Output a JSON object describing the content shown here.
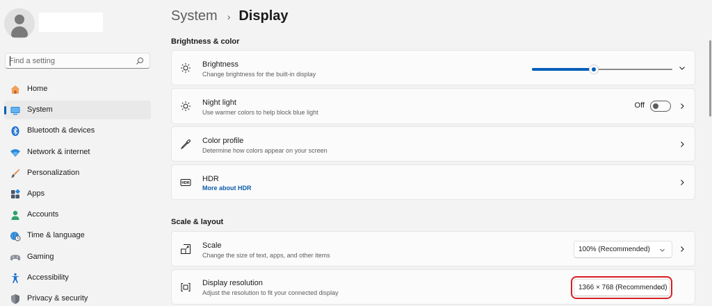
{
  "sidebar": {
    "search": {
      "placeholder": "Find a setting"
    },
    "items": [
      {
        "label": "Home",
        "icon": "home-icon",
        "active": false
      },
      {
        "label": "System",
        "icon": "system-icon",
        "active": true
      },
      {
        "label": "Bluetooth & devices",
        "icon": "bluetooth-icon",
        "active": false
      },
      {
        "label": "Network & internet",
        "icon": "wifi-icon",
        "active": false
      },
      {
        "label": "Personalization",
        "icon": "brush-icon",
        "active": false
      },
      {
        "label": "Apps",
        "icon": "apps-icon",
        "active": false
      },
      {
        "label": "Accounts",
        "icon": "accounts-icon",
        "active": false
      },
      {
        "label": "Time & language",
        "icon": "globe-clock-icon",
        "active": false
      },
      {
        "label": "Gaming",
        "icon": "gamepad-icon",
        "active": false
      },
      {
        "label": "Accessibility",
        "icon": "accessibility-icon",
        "active": false
      },
      {
        "label": "Privacy & security",
        "icon": "shield-icon",
        "active": false
      }
    ]
  },
  "header": {
    "parent": "System",
    "separator": "›",
    "current": "Display"
  },
  "sections": {
    "brightness_color": "Brightness & color",
    "scale_layout": "Scale & layout"
  },
  "cards": {
    "brightness": {
      "title": "Brightness",
      "desc": "Change brightness for the built-in display",
      "value_fraction": 0.44
    },
    "night_light": {
      "title": "Night light",
      "desc": "Use warmer colors to help block blue light",
      "state": "Off"
    },
    "color_profile": {
      "title": "Color profile",
      "desc": "Determine how colors appear on your screen"
    },
    "hdr": {
      "title": "HDR",
      "link": "More about HDR",
      "icon_text": "HDR"
    },
    "scale": {
      "title": "Scale",
      "desc": "Change the size of text, apps, and other items",
      "value": "100% (Recommended)"
    },
    "resolution": {
      "title": "Display resolution",
      "desc": "Adjust the resolution to fit your connected display",
      "value": "1366 × 768 (Recommended)"
    }
  },
  "colors": {
    "accent": "#005fb8",
    "highlight": "#d81e25",
    "background": "#f3f3f3",
    "card": "#fbfbfb"
  }
}
